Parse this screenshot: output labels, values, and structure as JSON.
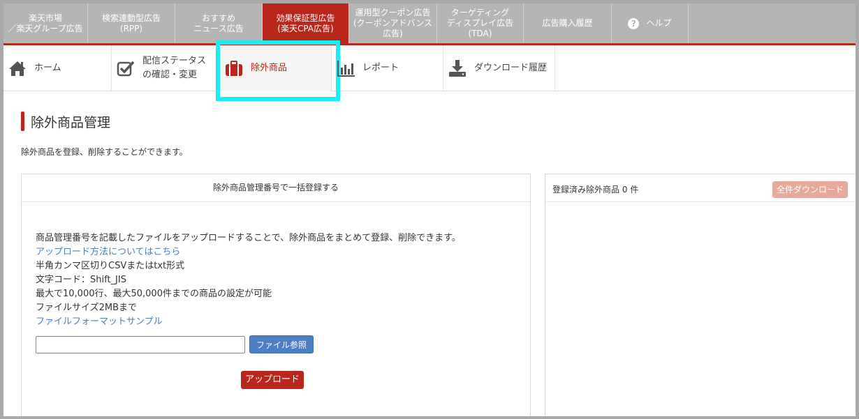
{
  "top_tabs": [
    {
      "label": "楽天市場\n／楽天グループ広告",
      "active": false
    },
    {
      "label": "検索連動型広告\n(RPP)",
      "active": false
    },
    {
      "label": "おすすめ\nニュース広告",
      "active": false
    },
    {
      "label": "効果保証型広告\n(楽天CPA広告)",
      "active": true
    },
    {
      "label": "運用型クーポン広告\n(クーポンアドバンス\n広告)",
      "active": false
    },
    {
      "label": "ターゲティング\nディスプレイ広告\n(TDA)",
      "active": false
    },
    {
      "label": "広告購入履歴",
      "active": false
    },
    {
      "label": "ヘルプ",
      "icon": "help-icon",
      "active": false
    }
  ],
  "sub_nav": [
    {
      "label": "ホーム",
      "icon": "home-icon"
    },
    {
      "label": "配信ステータス\nの確認・変更",
      "icon": "checkbox-icon"
    },
    {
      "label": "除外商品",
      "icon": "briefcase-icon",
      "active": true
    },
    {
      "label": "レポート",
      "icon": "bar-chart-icon"
    },
    {
      "label": "ダウンロード履歴",
      "icon": "download-icon"
    }
  ],
  "page": {
    "title": "除外商品管理",
    "description": "除外商品を登録、削除することができます。"
  },
  "bulk_panel": {
    "header": "除外商品管理番号で一括登録する",
    "intro": "商品管理番号を記載したファイルをアップロードすることで、除外商品をまとめて登録、削除できます。",
    "how_to_link": "アップロード方法についてはこちら",
    "format": "半角カンマ区切りCSVまたはtxt形式",
    "encoding": "文字コード：Shift_JIS",
    "limit": "最大で10,000行、最大50,000件までの商品の設定が可能",
    "file_size": "ファイルサイズ2MBまで",
    "sample_link": "ファイルフォーマットサンプル",
    "file_value": "",
    "browse_label": "ファイル参照",
    "upload_label": "アップロード"
  },
  "registered_panel": {
    "count_label": "登録済み除外商品 0 件",
    "download_all_label": "全件ダウンロード"
  },
  "colors": {
    "brand_red": "#b8261c",
    "tab_gray": "#b5b5b5",
    "link_blue": "#4a7ebb",
    "highlight": "#18eef5"
  }
}
